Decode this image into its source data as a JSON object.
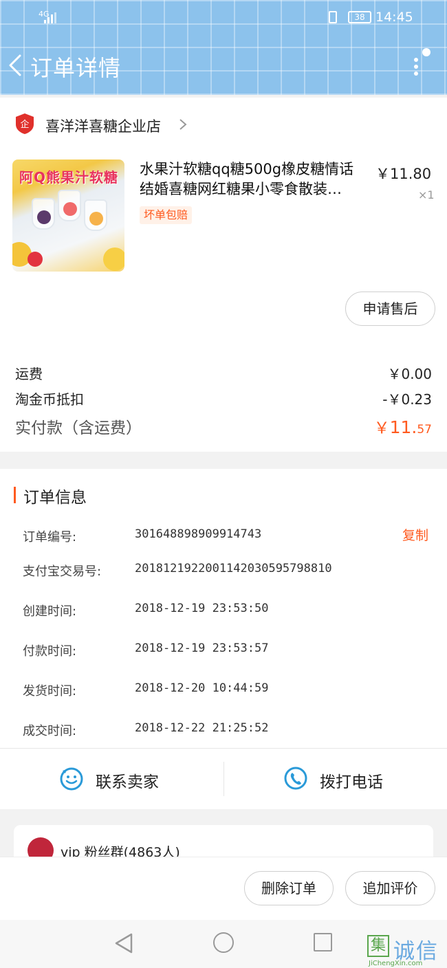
{
  "status_bar": {
    "network": "4G",
    "battery": "38",
    "time": "14:45"
  },
  "header": {
    "title": "订单详情"
  },
  "shop": {
    "name": "喜洋洋喜糖企业店"
  },
  "product": {
    "image_text": "阿Q熊果汁软糖",
    "title_line1": "水果汁软糖qq糖500g橡皮糖情话",
    "title_line2": "结婚喜糖网红糖果小零食散装…",
    "price": "￥11.80",
    "quantity": "×1",
    "tag": "坏单包赔"
  },
  "buttons": {
    "after_sale": "申请售后",
    "delete_order": "删除订单",
    "add_review": "追加评价"
  },
  "fees": {
    "shipping_label": "运费",
    "shipping_value": "￥0.00",
    "coin_label": "淘金币抵扣",
    "coin_value": "-￥0.23",
    "total_label": "实付款（含运费）",
    "total_symbol": "￥",
    "total_int": "11.",
    "total_dec": "57"
  },
  "order_info": {
    "section_title": "订单信息",
    "copy_label": "复制",
    "rows": [
      {
        "label": "订单编号:",
        "value": "301648898909914743"
      },
      {
        "label": "支付宝交易号:",
        "value": "2018121922001142030595798810"
      },
      {
        "label": "创建时间:",
        "value": "2018-12-19 23:53:50"
      },
      {
        "label": "付款时间:",
        "value": "2018-12-19 23:53:57"
      },
      {
        "label": "发货时间:",
        "value": "2018-12-20 10:44:59"
      },
      {
        "label": "成交时间:",
        "value": "2018-12-22 21:25:52"
      }
    ]
  },
  "contact": {
    "seller": "联系卖家",
    "call": "拨打电话"
  },
  "fan_group": {
    "name": "vip 粉丝群(4863人)"
  },
  "watermark": {
    "box": "集",
    "text": "诚信",
    "url": "JiChengXin.com"
  },
  "colors": {
    "accent": "#ff5a1f",
    "header_blue": "#8cc2ec",
    "icon_blue": "#2a9ad8"
  }
}
